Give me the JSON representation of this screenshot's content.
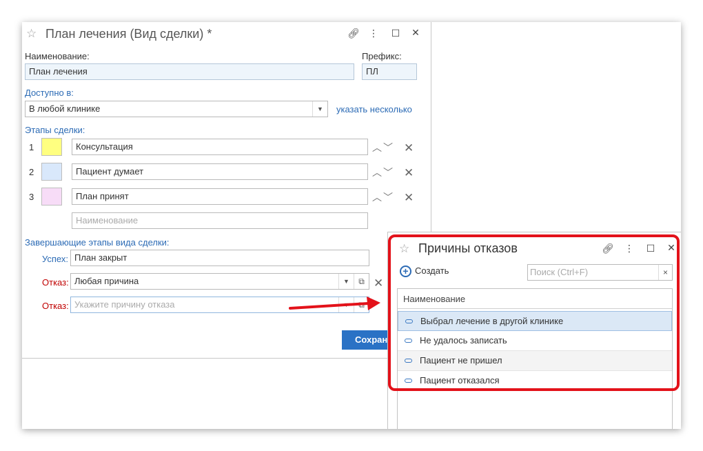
{
  "form": {
    "title": "План лечения (Вид сделки) *",
    "name_label": "Наименование:",
    "name_value": "План лечения",
    "prefix_label": "Префикс:",
    "prefix_value": "ПЛ",
    "available_label": "Доступно в:",
    "available_value": "В любой клинике",
    "specify_link": "указать несколько",
    "stages_label": "Этапы сделки:",
    "stages": [
      {
        "num": "1",
        "name": "Консультация",
        "color": "#ffff80"
      },
      {
        "num": "2",
        "name": "Пациент думает",
        "color": "#d9e8fb"
      },
      {
        "num": "3",
        "name": "План принят",
        "color": "#f7dcf7"
      }
    ],
    "new_stage_placeholder": "Наименование",
    "final_label": "Завершающие этапы вида сделки:",
    "success_label": "Успех:",
    "success_value": "План закрыт",
    "refusal_label": "Отказ:",
    "refusal_value": "Любая причина",
    "refusal2_label": "Отказ:",
    "refusal2_placeholder": "Укажите причину отказа",
    "save_label": "Сохранить и закрыть"
  },
  "dialog": {
    "title": "Причины отказов",
    "create_label": "Создать",
    "search_placeholder": "Поиск (Ctrl+F)",
    "column_header": "Наименование",
    "items": [
      "Выбрал лечение в другой клинике",
      "Не удалось записать",
      "Пациент не пришел",
      "Пациент отказался"
    ]
  },
  "colors": {
    "accent": "#2a72c5",
    "highlight": "#e3121a",
    "link": "#2c6bb5",
    "refusal": "#c00000"
  }
}
